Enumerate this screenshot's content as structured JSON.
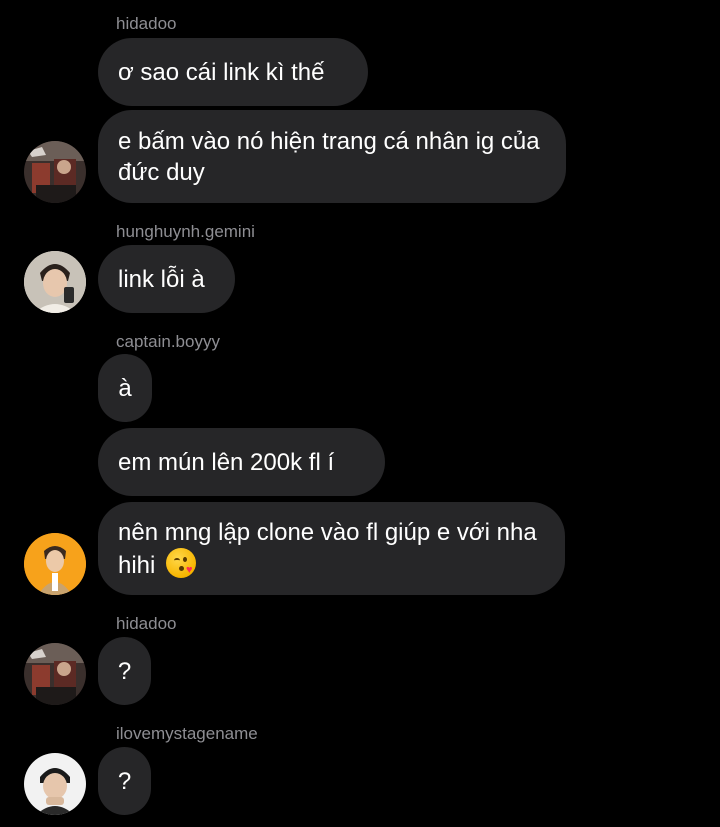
{
  "messages": [
    {
      "username": "hidadoo",
      "bubbles": [
        "ơ sao cái link kì thế",
        "e bấm vào nó hiện trang cá nhân ig của đức duy"
      ]
    },
    {
      "username": "hunghuynh.gemini",
      "bubbles": [
        "link lỗi à"
      ]
    },
    {
      "username": "captain.boyyy",
      "bubbles": [
        "à",
        "em mún lên 200k fl í",
        "nên mng lập clone vào fl giúp e với nha hihi"
      ],
      "emoji": "face-blowing-kiss"
    },
    {
      "username": "hidadoo",
      "bubbles": [
        "?"
      ]
    },
    {
      "username": "ilovemystagename",
      "bubbles": [
        "?"
      ]
    }
  ],
  "colors": {
    "background": "#000000",
    "bubble": "#262628",
    "username": "#8e8e93",
    "text": "#ffffff"
  }
}
